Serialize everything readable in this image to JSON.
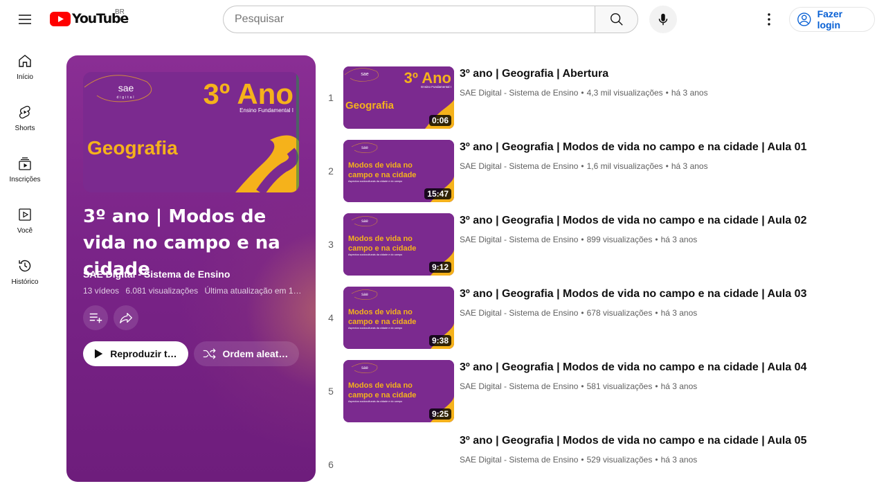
{
  "header": {
    "logo_text": "YouTube",
    "country": "BR",
    "search_placeholder": "Pesquisar",
    "login_label": "Fazer login"
  },
  "sidebar": {
    "items": [
      {
        "label": "Início",
        "icon": "home-icon"
      },
      {
        "label": "Shorts",
        "icon": "shorts-icon"
      },
      {
        "label": "Inscrições",
        "icon": "subscriptions-icon"
      },
      {
        "label": "Você",
        "icon": "you-icon"
      },
      {
        "label": "Histórico",
        "icon": "history-icon"
      }
    ]
  },
  "playlist": {
    "thumb_logo": "sae",
    "thumb_logo_sub": "digital",
    "thumb_grade": "3º Ano",
    "thumb_level": "Ensino Fundamental I",
    "thumb_subject": "Geografia",
    "title": "3º ano | Modos de vida no campo e na cidade",
    "channel": "SAE Digital - Sistema de Ensino",
    "video_count": "13 vídeos",
    "views": "6.081 visualizações",
    "updated": "Última atualização em 1...",
    "play_label": "Reproduzir tu...",
    "shuffle_label": "Ordem aleató..."
  },
  "thumb_text": {
    "logo": "sae",
    "logo_sub": "digital",
    "grade": "3º Ano",
    "level": "Ensino Fundamental I",
    "subject": "Geografia",
    "topic_line1": "Modos de vida no",
    "topic_line2": "campo e na cidade",
    "topic_sub": "Aspectos socioculturais da cidade e do campo"
  },
  "videos": [
    {
      "index": "1",
      "title": "3º ano | Geografia | Abertura",
      "channel": "SAE Digital - Sistema de Ensino",
      "views": "4,3 mil visualizações",
      "age": "há 3 anos",
      "duration": "0:06"
    },
    {
      "index": "2",
      "title": "3º ano | Geografia | Modos de vida no campo e na cidade | Aula 01",
      "channel": "SAE Digital - Sistema de Ensino",
      "views": "1,6 mil visualizações",
      "age": "há 3 anos",
      "duration": "15:47"
    },
    {
      "index": "3",
      "title": "3º ano | Geografia | Modos de vida no campo e na cidade | Aula 02",
      "channel": "SAE Digital - Sistema de Ensino",
      "views": "899 visualizações",
      "age": "há 3 anos",
      "duration": "9:12"
    },
    {
      "index": "4",
      "title": "3º ano | Geografia | Modos de vida no campo e na cidade | Aula 03",
      "channel": "SAE Digital - Sistema de Ensino",
      "views": "678 visualizações",
      "age": "há 3 anos",
      "duration": "9:38"
    },
    {
      "index": "5",
      "title": "3º ano | Geografia | Modos de vida no campo e na cidade | Aula 04",
      "channel": "SAE Digital - Sistema de Ensino",
      "views": "581 visualizações",
      "age": "há 3 anos",
      "duration": "9:25"
    },
    {
      "index": "6",
      "title": "3º ano | Geografia | Modos de vida no campo e na cidade | Aula 05",
      "channel": "SAE Digital - Sistema de Ensino",
      "views": "529 visualizações",
      "age": "há 3 anos",
      "duration": ""
    }
  ],
  "colors": {
    "brand_red": "#ff0000",
    "thumb_purple": "#7b2a8f",
    "thumb_yellow": "#f5b21b",
    "link_blue": "#065fd4"
  }
}
